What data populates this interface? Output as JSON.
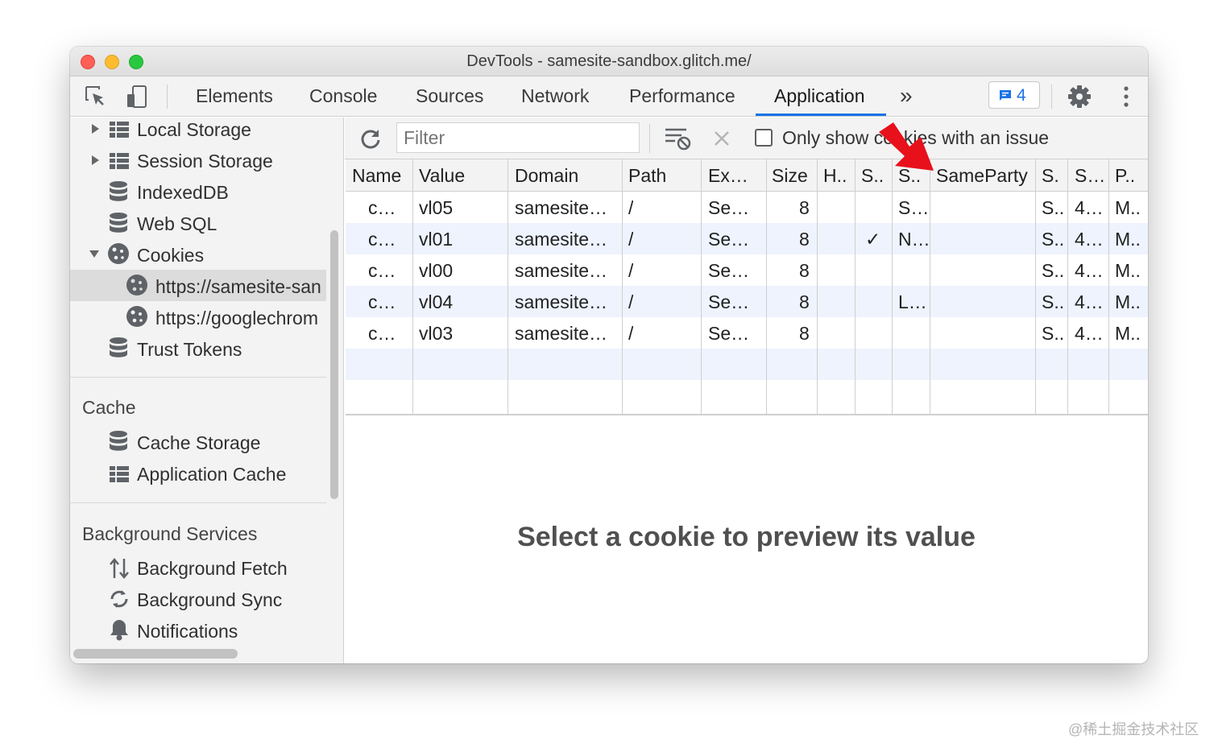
{
  "window": {
    "title": "DevTools - samesite-sandbox.glitch.me/"
  },
  "tabs": [
    "Elements",
    "Console",
    "Sources",
    "Network",
    "Performance",
    "Application"
  ],
  "tabs_more": "»",
  "issues_badge": {
    "count": "4"
  },
  "sidebar": {
    "storage_items": [
      {
        "label": "Local Storage",
        "icon": "table-icon"
      },
      {
        "label": "Session Storage",
        "icon": "table-icon"
      },
      {
        "label": "IndexedDB",
        "icon": "database-icon"
      },
      {
        "label": "Web SQL",
        "icon": "database-icon"
      },
      {
        "label": "Cookies",
        "icon": "cookie-icon"
      }
    ],
    "cookie_origins": [
      "https://samesite-san",
      "https://googlechrom"
    ],
    "trust_tokens": "Trust Tokens",
    "cache_heading": "Cache",
    "cache_items": [
      "Cache Storage",
      "Application Cache"
    ],
    "bg_heading": "Background Services",
    "bg_items": [
      "Background Fetch",
      "Background Sync",
      "Notifications"
    ]
  },
  "toolbar": {
    "filter_placeholder": "Filter",
    "only_show_label": "Only show cookies with an issue"
  },
  "table": {
    "headers": [
      "Name",
      "Value",
      "Domain",
      "Path",
      "Ex…",
      "Size",
      "H..",
      "S..",
      "S..",
      "SameParty",
      "S.",
      "S…",
      "P.."
    ],
    "rows": [
      [
        "c…",
        "vl05",
        "samesite…",
        "/",
        "Se…",
        "8",
        "",
        "",
        "S…",
        "",
        "S..",
        "4…",
        "M.."
      ],
      [
        "c…",
        "vl01",
        "samesite…",
        "/",
        "Se…",
        "8",
        "",
        "✓",
        "N…",
        "",
        "S..",
        "4…",
        "M.."
      ],
      [
        "c…",
        "vl00",
        "samesite…",
        "/",
        "Se…",
        "8",
        "",
        "",
        "",
        "",
        "S..",
        "4…",
        "M.."
      ],
      [
        "c…",
        "vl04",
        "samesite…",
        "/",
        "Se…",
        "8",
        "",
        "",
        "L…",
        "",
        "S..",
        "4…",
        "M.."
      ],
      [
        "c…",
        "vl03",
        "samesite…",
        "/",
        "Se…",
        "8",
        "",
        "",
        "",
        "",
        "S..",
        "4…",
        "M.."
      ]
    ]
  },
  "preview": {
    "empty_message": "Select a cookie to preview its value"
  },
  "annotation_arrow_color": "#e8101a",
  "watermark": "@稀土掘金技术社区"
}
